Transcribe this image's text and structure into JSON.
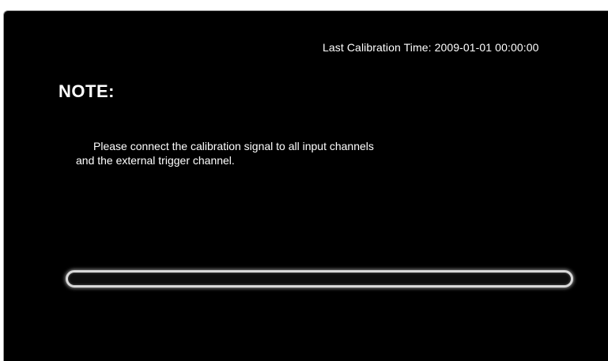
{
  "calibration": {
    "last_time_label": "Last Calibration Time: 2009-01-01 00:00:00"
  },
  "note": {
    "title": "NOTE:",
    "line1": "Please connect the calibration signal to all input channels",
    "line2": "and the external trigger channel."
  },
  "progress": {
    "value_fraction": 0
  },
  "colors": {
    "background": "#000000",
    "text": "#ffffff",
    "progress_border": "#d9d9d9"
  }
}
